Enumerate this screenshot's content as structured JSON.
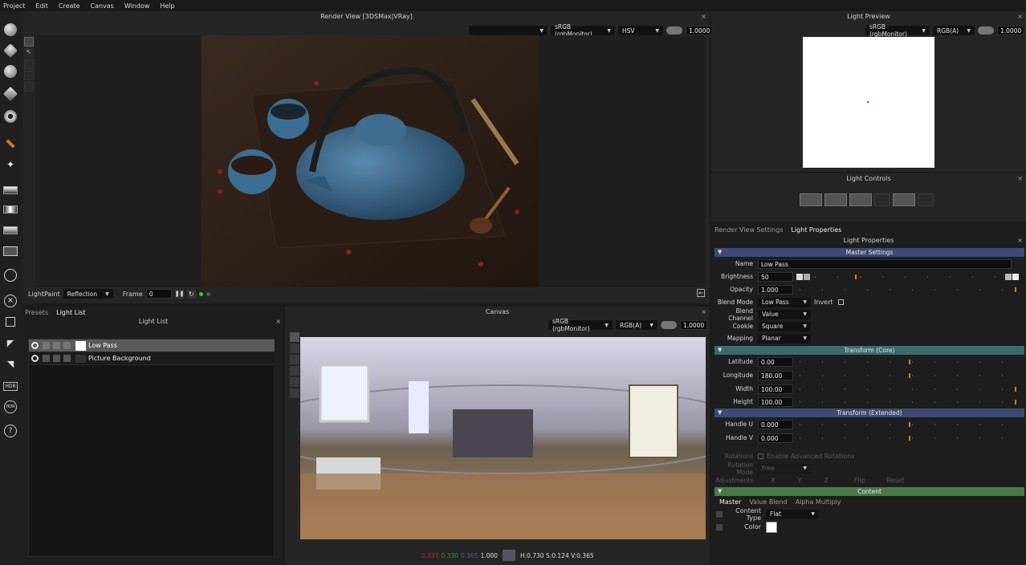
{
  "menu": [
    "Project",
    "Edit",
    "Create",
    "Canvas",
    "Window",
    "Help"
  ],
  "tools": [
    "sphere-light-tool",
    "box-light-tool",
    "ring-light-tool",
    "cube-light-tool",
    "gear-light-tool",
    "torch-tool",
    "sparkle-tool",
    "gradient-tool",
    "gradient-tool-2",
    "gradient-tool-3",
    "image-tool",
    "atom-tool",
    "close-tool",
    "frame-tool",
    "angle-tool",
    "arrow-tool",
    "hdr-tool",
    "hdr-refresh-tool",
    "help-tool"
  ],
  "hdr_labels": {
    "hdr": "HDR",
    "hdr2": "HDR"
  },
  "help_label": "?",
  "render_view": {
    "title": "Render View [3DSMax|VRay]",
    "color_space": "sRGB (rgbMonitor)",
    "mode": "HSV",
    "exposure": "1.0000",
    "lightpaint_label": "LightPaint",
    "lightpaint_value": "Reflection",
    "frame_label": "Frame",
    "frame_value": "0"
  },
  "light_preview": {
    "title": "Light Preview",
    "color_space": "sRGB (rgbMonitor)",
    "mode": "RGB(A)",
    "exposure": "1.0000"
  },
  "light_controls": {
    "title": "Light Controls"
  },
  "light_list_panel": {
    "tabs": [
      "Presets",
      "Light List"
    ],
    "title": "Light List",
    "items": [
      {
        "name": "Low Pass",
        "selected": true
      },
      {
        "name": "Picture Background",
        "selected": false
      }
    ]
  },
  "canvas": {
    "title": "Canvas",
    "color_space": "sRGB (rgbMonitor)",
    "mode": "RGB(A)",
    "exposure": "1.0000",
    "readout_r": "0.337",
    "readout_g": "0.330",
    "readout_b": "0.365",
    "readout_a": "1.000",
    "readout_hsv": "H:0.730 S:0.124 V:0.365"
  },
  "properties": {
    "tabs": [
      "Render View Settings",
      "Light Properties"
    ],
    "title": "Light Properties",
    "master_section": "Master Settings",
    "name_label": "Name",
    "name_value": "Low Pass",
    "brightness_label": "Brightness",
    "brightness_value": "50",
    "opacity_label": "Opacity",
    "opacity_value": "1.000",
    "blend_mode_label": "Blend Mode",
    "blend_mode_value": "Low Pass",
    "invert_label": "Invert",
    "blend_channel_label": "Blend Channel",
    "blend_channel_value": "Value",
    "cookie_label": "Cookie",
    "cookie_value": "Square",
    "mapping_label": "Mapping",
    "mapping_value": "Planar",
    "transform_core_section": "Transform (Core)",
    "latitude_label": "Latitude",
    "latitude_value": "0.00",
    "longitude_label": "Longitude",
    "longitude_value": "180.00",
    "width_label": "Width",
    "width_value": "100.00",
    "height_label": "Height",
    "height_value": "100.00",
    "transform_ext_section": "Transform (Extended)",
    "handle_u_label": "Handle U",
    "handle_u_value": "0.000",
    "handle_v_label": "Handle V",
    "handle_v_value": "0.000",
    "rotations_label": "Rotations",
    "adv_rot_label": "Enable Advanced Rotations",
    "rotation_mode_label": "Rotation Mode",
    "rotation_mode_value": "Free",
    "adjustments_label": "Adjustments",
    "adj_x": "X",
    "adj_y": "Y",
    "adj_z": "Z",
    "flip_label": "Flip",
    "reset_label": "Reset",
    "content_section": "Content",
    "content_tabs": [
      "Master",
      "Value Blend",
      "Alpha Multiply"
    ],
    "content_type_label": "Content Type",
    "content_type_value": "Flat",
    "color_label": "Color"
  },
  "colors": {
    "accent_orange": "#e07a10",
    "section_blue": "#3e4a72",
    "section_teal": "#3d6a6c",
    "section_green": "#4a7a4a"
  }
}
